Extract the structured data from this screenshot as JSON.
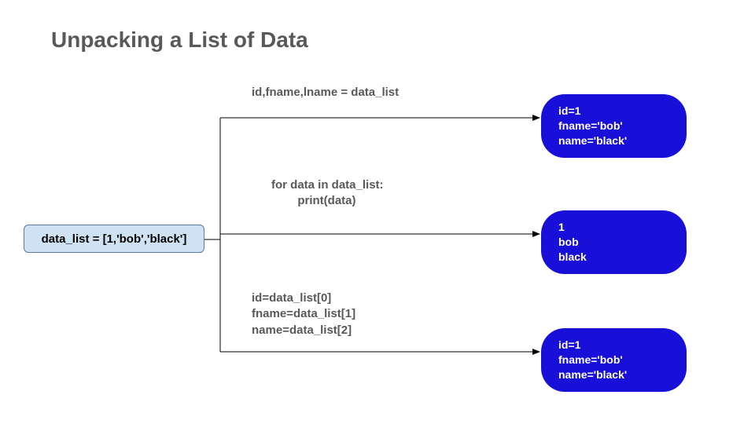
{
  "title": "Unpacking a List of Data",
  "source": "data_list = [1,'bob','black']",
  "branches": [
    {
      "code": "id,fname,lname = data_list",
      "output": "id=1\nfname='bob'\nname='black'"
    },
    {
      "code": "for data in data_list:\n        print(data)",
      "output": "1\nbob\nblack"
    },
    {
      "code": "id=data_list[0]\nfname=data_list[1]\nname=data_list[2]",
      "output": "id=1\nfname='bob'\nname='black'"
    }
  ]
}
